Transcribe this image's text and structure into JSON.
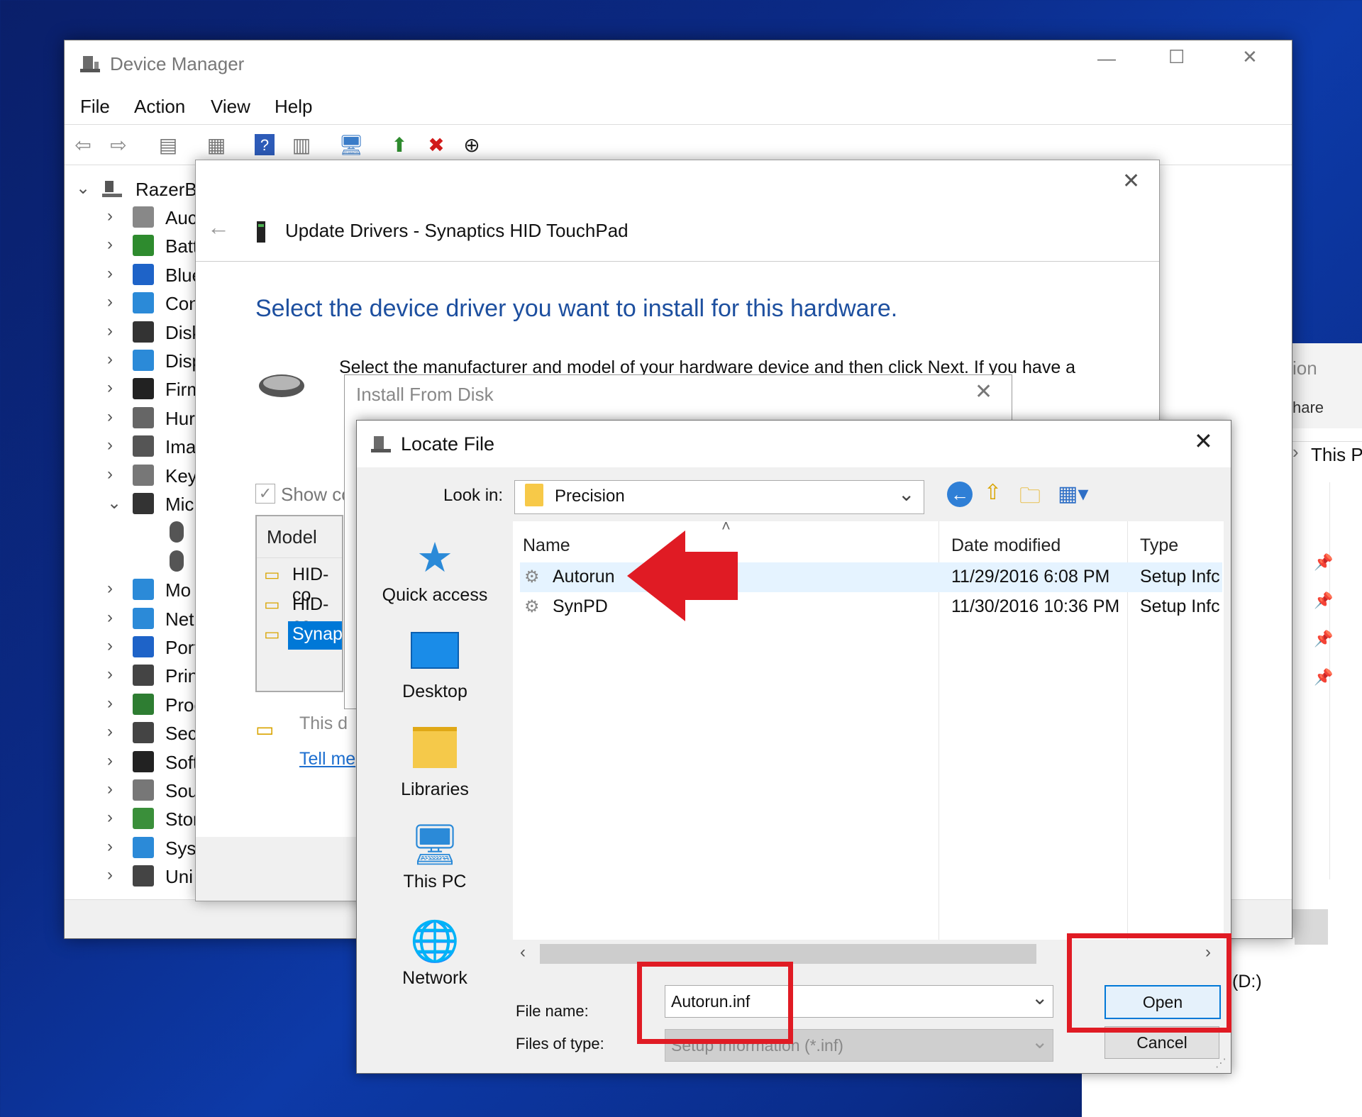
{
  "device_manager": {
    "title": "Device Manager",
    "menu": [
      "File",
      "Action",
      "View",
      "Help"
    ],
    "tree": {
      "root": "RazerBl",
      "items": [
        "Auc",
        "Batt",
        "Blue",
        "Con",
        "Disk",
        "Disp",
        "Firm",
        "Hur",
        "Ima",
        "Key",
        "Mic",
        "",
        "",
        "Mo",
        "Net",
        "Port",
        "Prin",
        "Proc",
        "Secu",
        "Soft",
        "Sou",
        "Stor",
        "Syst",
        "Uni"
      ]
    }
  },
  "update_drivers": {
    "title": "Update Drivers - Synaptics HID TouchPad",
    "heading": "Select the device driver you want to install for this hardware.",
    "description": "Select the manufacturer and model of your hardware device and then click Next. If you have a",
    "show_compatible": "Show co",
    "model_header": "Model",
    "models": [
      "HID-co",
      "HID-co",
      "Synap"
    ],
    "signed_note": "This d",
    "tell_me": "Tell me"
  },
  "install_from_disk": {
    "title": "Install From Disk"
  },
  "locate_file": {
    "title": "Locate File",
    "look_in_label": "Look in:",
    "look_in_value": "Precision",
    "places": [
      "Quick access",
      "Desktop",
      "Libraries",
      "This PC",
      "Network"
    ],
    "columns": [
      "Name",
      "Date modified",
      "Type"
    ],
    "files": [
      {
        "name": "Autorun",
        "date": "11/29/2016 6:08 PM",
        "type": "Setup Infc"
      },
      {
        "name": "SynPD",
        "date": "11/30/2016 10:36 PM",
        "type": "Setup Infc"
      }
    ],
    "file_name_label": "File name:",
    "file_name_value": "Autorun.inf",
    "files_of_type_label": "Files of type:",
    "files_of_type_value": "Setup Information (*.inf)",
    "open_label": "Open",
    "cancel_label": "Cancel"
  },
  "background_explorer": {
    "fragments": [
      "ion",
      "hare",
      "This P",
      "(D:)"
    ]
  },
  "colors": {
    "accent_red": "#e01b24",
    "heading_blue": "#1d4f9f",
    "selection": "#cce8ff"
  }
}
